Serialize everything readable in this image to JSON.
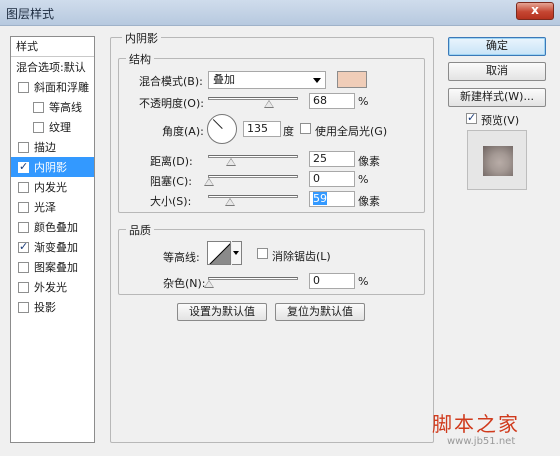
{
  "window": {
    "title": "图层样式",
    "close_symbol": "x"
  },
  "style_list": {
    "header": "样式",
    "blend_options": "混合选项:默认",
    "items": [
      {
        "label": "斜面和浮雕",
        "checked": false
      },
      {
        "label": "等高线",
        "checked": false
      },
      {
        "label": "纹理",
        "checked": false
      },
      {
        "label": "描边",
        "checked": false
      },
      {
        "label": "内阴影",
        "checked": true
      },
      {
        "label": "内发光",
        "checked": false
      },
      {
        "label": "光泽",
        "checked": false
      },
      {
        "label": "颜色叠加",
        "checked": false
      },
      {
        "label": "渐变叠加",
        "checked": true
      },
      {
        "label": "图案叠加",
        "checked": false
      },
      {
        "label": "外发光",
        "checked": false
      },
      {
        "label": "投影",
        "checked": false
      }
    ]
  },
  "panel": {
    "title": "内阴影",
    "structure": {
      "title": "结构",
      "blend_mode_label": "混合模式(B):",
      "blend_mode_value": "叠加",
      "color_swatch": "#f0cdb8",
      "opacity_label": "不透明度(O):",
      "opacity_value": "68",
      "opacity_unit": "%",
      "opacity_level": 0.68,
      "angle_label": "角度(A):",
      "angle_value": "135",
      "angle_unit": "度",
      "global_light_label": "使用全局光(G)",
      "global_light_checked": false,
      "distance_label": "距离(D):",
      "distance_value": "25",
      "distance_unit": "像素",
      "distance_level": 0.25,
      "choke_label": "阻塞(C):",
      "choke_value": "0",
      "choke_unit": "%",
      "choke_level": 0,
      "size_label": "大小(S):",
      "size_value": "59",
      "size_unit": "像素",
      "size_level": 0.24
    },
    "quality": {
      "title": "品质",
      "contour_label": "等高线:",
      "antialias_label": "消除锯齿(L)",
      "antialias_checked": false,
      "noise_label": "杂色(N):",
      "noise_value": "0",
      "noise_unit": "%",
      "noise_level": 0
    },
    "make_default": "设置为默认值",
    "reset_default": "复位为默认值"
  },
  "actions": {
    "ok": "确定",
    "cancel": "取消",
    "new_style": "新建样式(W)...",
    "preview_label": "预览(V)",
    "preview_checked": true
  },
  "watermark": {
    "main": "脚本之家",
    "url": "www.jb51.net"
  }
}
